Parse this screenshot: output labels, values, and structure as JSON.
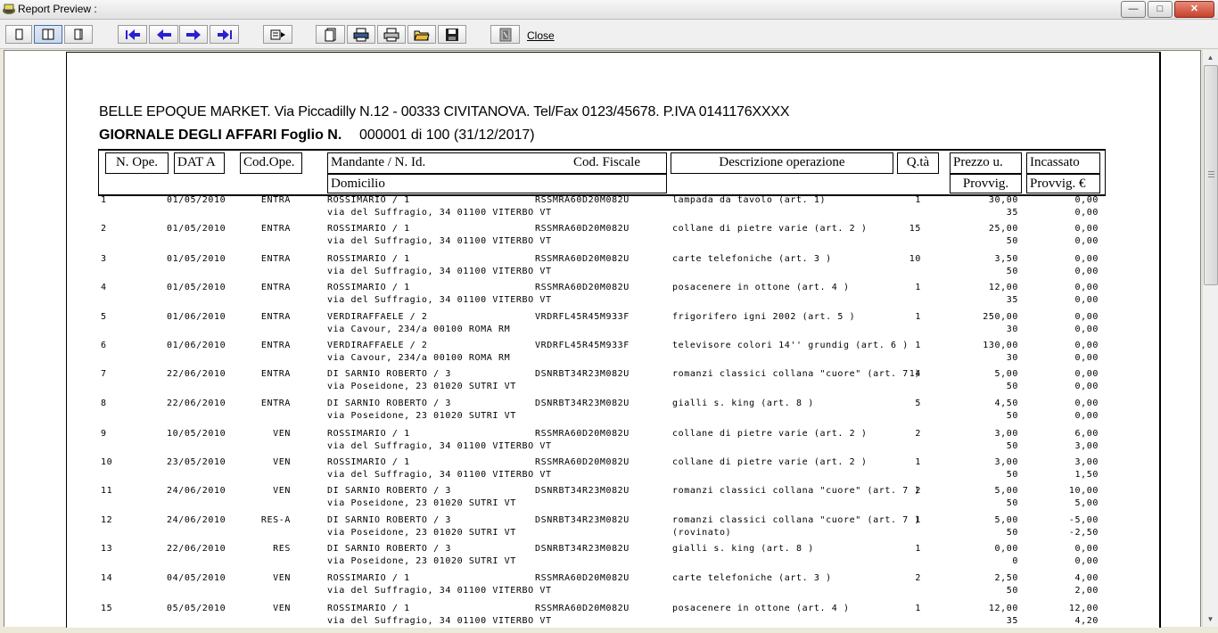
{
  "window": {
    "title": "Report Preview :"
  },
  "toolbar": {
    "close_label": "Close"
  },
  "report": {
    "company_line": "BELLE EPOQUE MARKET. Via Piccadilly N.12 - 00333 CIVITANOVA. Tel/Fax 0123/45678. P.IVA 0141176XXXX",
    "journal_title": "GIORNALE DEGLI AFFARI Foglio N.",
    "journal_number": "000001 di 100 (31/12/2017)",
    "headers": {
      "n_ope": "N. Ope.",
      "data": "DAT A",
      "cod_ope": "Cod.Ope.",
      "mandante": "Mandante / N. Id.",
      "cod_fiscale": "Cod. Fiscale",
      "domicilio": "Domicilio",
      "descrizione": "Descrizione operazione",
      "qta": "Q.tà",
      "prezzo": "Prezzo u.",
      "provvig": "Provvig.",
      "incassato": "Incassato",
      "provvig_eur": "Provvig. €"
    },
    "rows": [
      {
        "num": "1",
        "date": "01/05/2010",
        "code": "ENTRA",
        "name": "ROSSIMARIO / 1",
        "addr": "via del Suffragio, 34 01100 VITERBO VT",
        "fiscal": "RSSMRA60D20M082U",
        "desc": "lampada da tavolo (art. 1)",
        "desc2": "",
        "qty": "1",
        "price": "30,00",
        "prov": "35",
        "incassato": "0,00",
        "provv_eur": "0,00"
      },
      {
        "num": "2",
        "date": "01/05/2010",
        "code": "ENTRA",
        "name": "ROSSIMARIO / 1",
        "addr": "via del Suffragio, 34 01100 VITERBO VT",
        "fiscal": "RSSMRA60D20M082U",
        "desc": "collane di pietre varie (art. 2 )",
        "desc2": "",
        "qty": "15",
        "price": "25,00",
        "prov": "50",
        "incassato": "0,00",
        "provv_eur": "0,00"
      },
      {
        "num": "3",
        "date": "01/05/2010",
        "code": "ENTRA",
        "name": "ROSSIMARIO / 1",
        "addr": "via del Suffragio, 34 01100 VITERBO VT",
        "fiscal": "RSSMRA60D20M082U",
        "desc": "carte telefoniche (art. 3 )",
        "desc2": "",
        "qty": "10",
        "price": "3,50",
        "prov": "50",
        "incassato": "0,00",
        "provv_eur": "0,00"
      },
      {
        "num": "4",
        "date": "01/05/2010",
        "code": "ENTRA",
        "name": "ROSSIMARIO / 1",
        "addr": "via del Suffragio, 34 01100 VITERBO VT",
        "fiscal": "RSSMRA60D20M082U",
        "desc": "posacenere in ottone (art. 4 )",
        "desc2": "",
        "qty": "1",
        "price": "12,00",
        "prov": "35",
        "incassato": "0,00",
        "provv_eur": "0,00"
      },
      {
        "num": "5",
        "date": "01/06/2010",
        "code": "ENTRA",
        "name": "VERDIRAFFAELE / 2",
        "addr": "via Cavour, 234/a 00100 ROMA RM",
        "fiscal": "VRDRFL45R45M933F",
        "desc": "frigorifero igni 2002 (art. 5 )",
        "desc2": "",
        "qty": "1",
        "price": "250,00",
        "prov": "30",
        "incassato": "0,00",
        "provv_eur": "0,00"
      },
      {
        "num": "6",
        "date": "01/06/2010",
        "code": "ENTRA",
        "name": "VERDIRAFFAELE / 2",
        "addr": "via Cavour, 234/a 00100 ROMA RM",
        "fiscal": "VRDRFL45R45M933F",
        "desc": "televisore colori 14'' grundig (art. 6 )",
        "desc2": "",
        "qty": "1",
        "price": "130,00",
        "prov": "30",
        "incassato": "0,00",
        "provv_eur": "0,00"
      },
      {
        "num": "7",
        "date": "22/06/2010",
        "code": "ENTRA",
        "name": "DI SARNIO ROBERTO / 3",
        "addr": "via Poseidone, 23 01020 SUTRI VT",
        "fiscal": "DSNRBT34R23M082U",
        "desc": "romanzi classici collana \"cuore\" (art. 7 )",
        "desc2": "",
        "qty": "14",
        "price": "5,00",
        "prov": "50",
        "incassato": "0,00",
        "provv_eur": "0,00"
      },
      {
        "num": "8",
        "date": "22/06/2010",
        "code": "ENTRA",
        "name": "DI SARNIO ROBERTO / 3",
        "addr": "via Poseidone, 23 01020 SUTRI VT",
        "fiscal": "DSNRBT34R23M082U",
        "desc": "gialli s. king (art. 8 )",
        "desc2": "",
        "qty": "5",
        "price": "4,50",
        "prov": "50",
        "incassato": "0,00",
        "provv_eur": "0,00"
      },
      {
        "num": "9",
        "date": "10/05/2010",
        "code": "VEN",
        "name": "ROSSIMARIO / 1",
        "addr": "via del Suffragio, 34 01100 VITERBO VT",
        "fiscal": "RSSMRA60D20M082U",
        "desc": "collane di pietre varie (art. 2 )",
        "desc2": "",
        "qty": "2",
        "price": "3,00",
        "prov": "50",
        "incassato": "6,00",
        "provv_eur": "3,00"
      },
      {
        "num": "10",
        "date": "23/05/2010",
        "code": "VEN",
        "name": "ROSSIMARIO / 1",
        "addr": "via del Suffragio, 34 01100 VITERBO VT",
        "fiscal": "RSSMRA60D20M082U",
        "desc": "collane di pietre varie (art. 2 )",
        "desc2": "",
        "qty": "1",
        "price": "3,00",
        "prov": "50",
        "incassato": "3,00",
        "provv_eur": "1,50"
      },
      {
        "num": "11",
        "date": "24/06/2010",
        "code": "VEN",
        "name": "DI SARNIO ROBERTO / 3",
        "addr": "via Poseidone, 23 01020 SUTRI VT",
        "fiscal": "DSNRBT34R23M082U",
        "desc": "romanzi classici collana \"cuore\" (art. 7 )",
        "desc2": "",
        "qty": "2",
        "price": "5,00",
        "prov": "50",
        "incassato": "10,00",
        "provv_eur": "5,00"
      },
      {
        "num": "12",
        "date": "24/06/2010",
        "code": "RES-A",
        "name": "DI SARNIO ROBERTO / 3",
        "addr": "via Poseidone, 23 01020 SUTRI VT",
        "fiscal": "DSNRBT34R23M082U",
        "desc": "romanzi classici collana \"cuore\" (art. 7 )",
        "desc2": "(rovinato)",
        "qty": "1",
        "price": "5,00",
        "prov": "50",
        "incassato": "-5,00",
        "provv_eur": "-2,50"
      },
      {
        "num": "13",
        "date": "22/06/2010",
        "code": "RES",
        "name": "DI SARNIO ROBERTO / 3",
        "addr": "via Poseidone, 23 01020 SUTRI VT",
        "fiscal": "DSNRBT34R23M082U",
        "desc": "gialli s. king (art. 8 )",
        "desc2": "",
        "qty": "1",
        "price": "0,00",
        "prov": "0",
        "incassato": "0,00",
        "provv_eur": "0,00"
      },
      {
        "num": "14",
        "date": "04/05/2010",
        "code": "VEN",
        "name": "ROSSIMARIO / 1",
        "addr": "via del Suffragio, 34 01100 VITERBO VT",
        "fiscal": "RSSMRA60D20M082U",
        "desc": "carte telefoniche (art. 3 )",
        "desc2": "",
        "qty": "2",
        "price": "2,50",
        "prov": "50",
        "incassato": "4,00",
        "provv_eur": "2,00"
      },
      {
        "num": "15",
        "date": "05/05/2010",
        "code": "VEN",
        "name": "ROSSIMARIO / 1",
        "addr": "via del Suffragio, 34 01100 VITERBO VT",
        "fiscal": "RSSMRA60D20M082U",
        "desc": "posacenere in ottone (art. 4 )",
        "desc2": "",
        "qty": "1",
        "price": "12,00",
        "prov": "35",
        "incassato": "12,00",
        "provv_eur": "4,20"
      }
    ]
  },
  "colors": {
    "nav_arrow": "#2a1fd1",
    "close_button": "#c8412b"
  }
}
